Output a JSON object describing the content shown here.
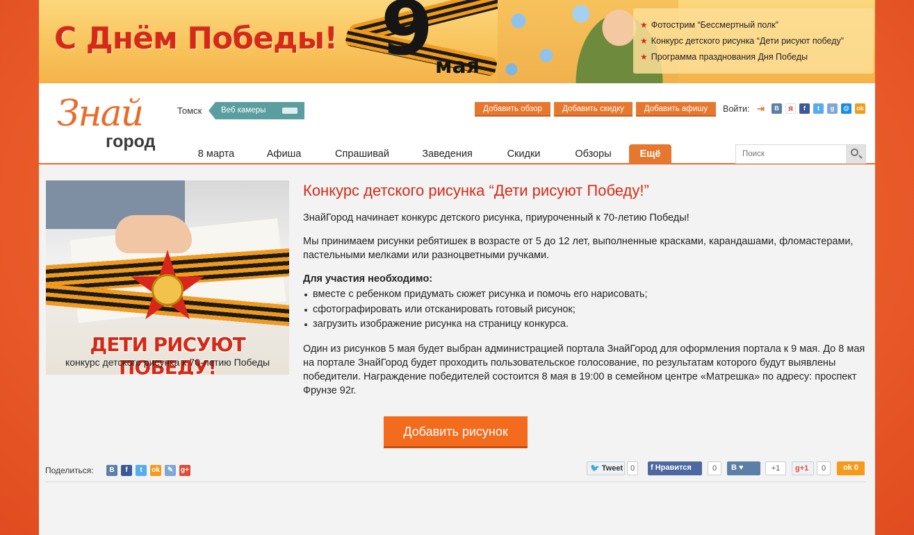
{
  "colors": {
    "accent": "#e6772e",
    "brand_red": "#d52a17",
    "cta": "#f36b1c",
    "webcam": "#5b9e9f"
  },
  "banner": {
    "title": "С Днём Победы!",
    "day": "9",
    "month": "мая",
    "links": [
      "Фотострим “Бессмертный полк”",
      "Конкурс детского рисунка “Дети рисуют победу”",
      "Программа празднования Дня Победы"
    ],
    "star_icon": "star-icon"
  },
  "header": {
    "logo_script": "Знай",
    "logo_word": "город",
    "city": "Томск",
    "webcam_label": "Веб камеры",
    "actions": [
      "Добавить обзор",
      "Добавить скидку",
      "Добавить афишу"
    ],
    "login_label": "Войти:",
    "login_networks": [
      "login-icon",
      "vk-icon",
      "yandex-icon",
      "facebook-icon",
      "twitter-icon",
      "google-icon",
      "mailru-icon",
      "odnoklassniki-icon"
    ],
    "nav": [
      "8 марта",
      "Афиша",
      "Спрашивай",
      "Заведения",
      "Скидки",
      "Обзоры",
      "Ещё"
    ],
    "nav_active": "Ещё",
    "search_placeholder": "Поиск"
  },
  "promo": {
    "title": "ДЕТИ РИСУЮТ ПОБЕДУ!",
    "subtitle": "конкурс детского рисунка к 70-летию Победы"
  },
  "article": {
    "title": "Конкурс детского рисунка “Дети рисуют Победу!”",
    "intro": "ЗнайГород начинает конкурс детского рисунка, приуроченный к 70-летию Победы!",
    "paragraph2": "Мы принимаем рисунки ребятишек в возрасте от 5 до 12 лет, выполненные красками, карандашами, фломастерами, пастельными мелками или разноцветными ручками.",
    "requirements_title": "Для участия необходимо:",
    "requirements": [
      "вместе с ребенком придумать сюжет рисунка и помочь его нарисовать;",
      "сфотографировать или отсканировать готовый рисунок;",
      "загрузить изображение рисунка на страницу конкурса."
    ],
    "paragraph3": "Один из рисунков 5 мая будет выбран администрацией портала ЗнайГород для оформления портала к 9 мая. До 8 мая на портале ЗнайГород будет проходить пользовательское голосование, по результатам которого будут выявлены победители. Награждение победителей состоится 8 мая в 19:00 в семейном центре «Матрешка» по адресу: проспект Фрунзе 92г.",
    "cta": "Добавить рисунок"
  },
  "share": {
    "label": "Поделиться:",
    "icons": [
      "vk-icon",
      "facebook-icon",
      "twitter-icon",
      "odnoklassniki-icon",
      "livejournal-icon",
      "google-plus-icon"
    ],
    "widgets": {
      "tweet_label": "Tweet",
      "tweet_count": "0",
      "fb_label": "Нравится",
      "fb_count": "0",
      "vk_label": "В",
      "vk_count": "+1",
      "gplus_label": "+1",
      "gplus_count": "0",
      "ok_count": "0"
    }
  }
}
